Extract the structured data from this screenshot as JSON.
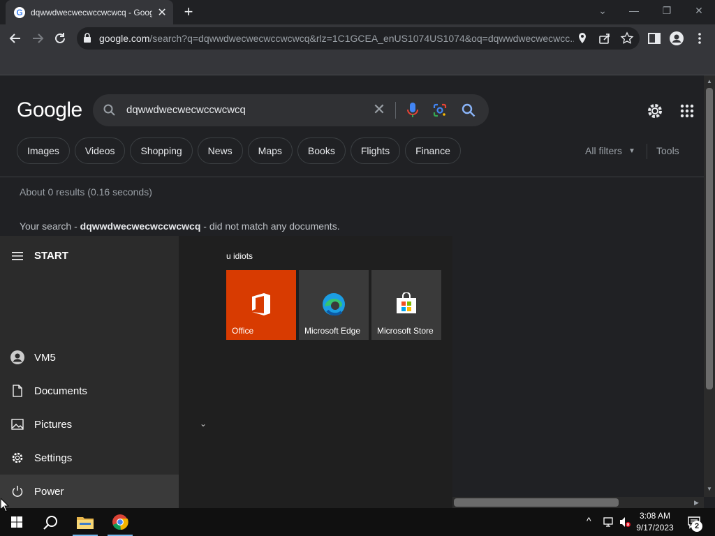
{
  "browser": {
    "tab_title": "dqwwdwecwecwccwcwcq - Google Search",
    "favicon_letter": "G",
    "tab_close": "✕",
    "new_tab": "+",
    "window_controls": {
      "dropdown": "⌄",
      "minimize": "—",
      "restore": "❐",
      "close": "✕"
    },
    "url_host": "google.com",
    "url_rest": "/search?q=dqwwdwecwecwccwcwcq&rlz=1C1GCEA_enUS1074US1074&oq=dqwwdwecwecwcc..."
  },
  "search": {
    "logo": "Google",
    "query": "dqwwdwecwecwccwcwcq",
    "chips": [
      "Images",
      "Videos",
      "Shopping",
      "News",
      "Maps",
      "Books",
      "Flights",
      "Finance"
    ],
    "all_filters": "All filters",
    "tools": "Tools",
    "result_stats": "About 0 results (0.16 seconds)",
    "no_match_prefix": "Your search - ",
    "no_match_query": "dqwwdwecwecwccwcwcq",
    "no_match_suffix": " - did not match any documents."
  },
  "start_menu": {
    "title": "START",
    "items": [
      {
        "label": "VM5",
        "icon": "user-avatar-icon"
      },
      {
        "label": "Documents",
        "icon": "document-icon"
      },
      {
        "label": "Pictures",
        "icon": "pictures-icon"
      },
      {
        "label": "Settings",
        "icon": "settings-gear-icon"
      },
      {
        "label": "Power",
        "icon": "power-icon"
      }
    ],
    "group_name": "u idiots",
    "tiles": [
      {
        "label": "Office",
        "color": "#d83b01"
      },
      {
        "label": "Microsoft Edge",
        "color": "#3a3a3a"
      },
      {
        "label": "Microsoft Store",
        "color": "#3a3a3a"
      }
    ]
  },
  "taskbar": {
    "time": "3:08 AM",
    "date": "9/17/2023",
    "notification_count": "2"
  }
}
